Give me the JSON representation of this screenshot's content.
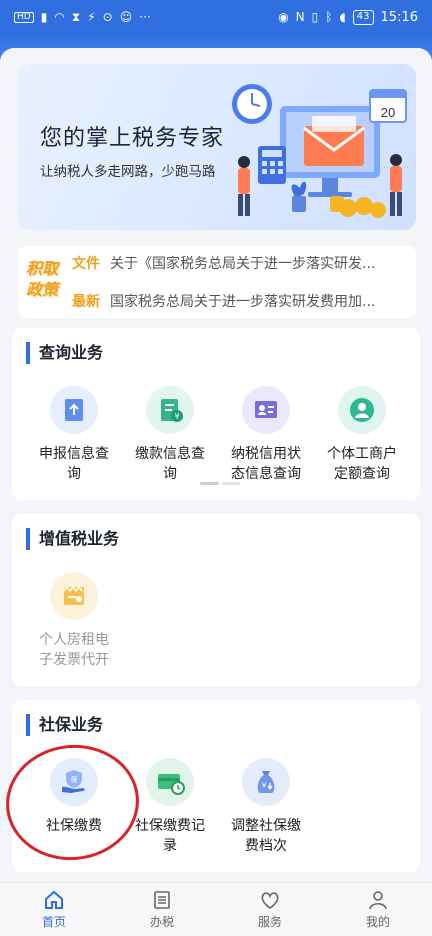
{
  "status_bar": {
    "left_icons": [
      "hd-icon",
      "signal-icon",
      "wifi-icon",
      "hourglass-icon",
      "flash-icon",
      "search-app-icon",
      "bot-icon",
      "more-icon"
    ],
    "hd": "HD",
    "more": "···",
    "battery": "43",
    "time": "15:16"
  },
  "banner": {
    "title": "您的掌上税务专家",
    "subtitle": "让纳税人多走网路，少跑马路",
    "calendar_day": "20"
  },
  "news": {
    "badge_line1": "积取",
    "badge_line2": "政策",
    "items": [
      {
        "tag": "文件",
        "text": "关于《国家税务总局关于进一步落实研发..."
      },
      {
        "tag": "最新",
        "text": "国家税务总局关于进一步落实研发费用加..."
      }
    ]
  },
  "sections": {
    "query": {
      "title": "查询业务",
      "items": [
        {
          "label1": "申报信息查",
          "label2": "询"
        },
        {
          "label1": "缴款信息查",
          "label2": "询"
        },
        {
          "label1": "纳税信用状",
          "label2": "态信息查询"
        },
        {
          "label1": "个体工商户",
          "label2": "定额查询"
        }
      ]
    },
    "vat": {
      "title": "增值税业务",
      "items": [
        {
          "label1": "个人房租电",
          "label2": "子发票代开"
        }
      ]
    },
    "social": {
      "title": "社保业务",
      "items": [
        {
          "label1": "社保缴费",
          "label2": ""
        },
        {
          "label1": "社保缴费记",
          "label2": "录"
        },
        {
          "label1": "调整社保缴",
          "label2": "费档次"
        }
      ]
    }
  },
  "tabbar": {
    "tabs": [
      {
        "label": "首页"
      },
      {
        "label": "办税"
      },
      {
        "label": "服务"
      },
      {
        "label": "我的"
      }
    ]
  },
  "colors": {
    "primary": "#2f6fe0",
    "accent": "#f0a020",
    "annotation": "#d8232a"
  }
}
